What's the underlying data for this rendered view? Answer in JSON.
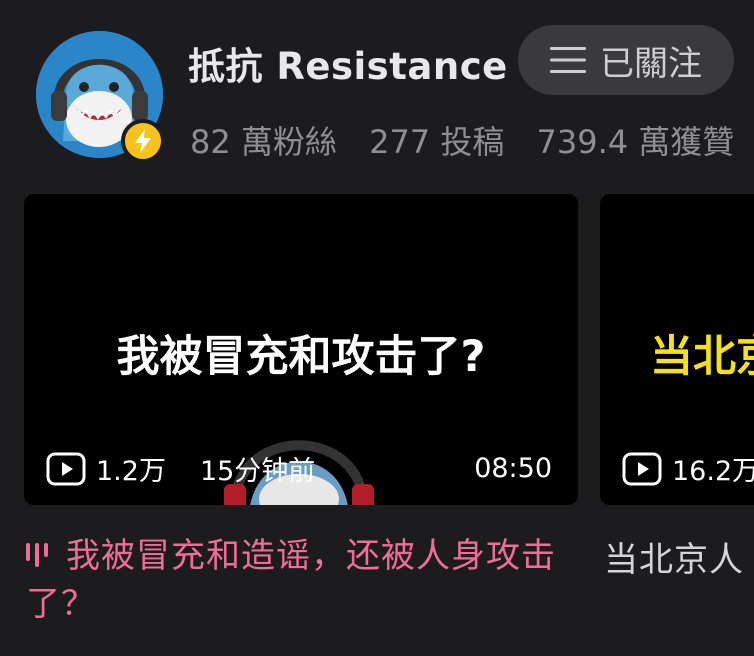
{
  "profile": {
    "name": "抵抗 Resistance",
    "follow_label": "已關注",
    "stats": [
      "82 萬粉絲",
      "277 投稿",
      "739.4 萬獲贊"
    ]
  },
  "videos": [
    {
      "cover_text": "我被冒充和攻击了?",
      "views": "1.2万",
      "time_ago": "15分钟前",
      "duration": "08:50",
      "title": "我被冒充和造谣，还被人身攻击了？"
    },
    {
      "cover_text": "当北京",
      "views": "16.2万",
      "title": "当北京人"
    }
  ],
  "colors": {
    "background": "#1c1c1e",
    "playing_title": "#f06d96",
    "badge": "#f6c21b"
  }
}
